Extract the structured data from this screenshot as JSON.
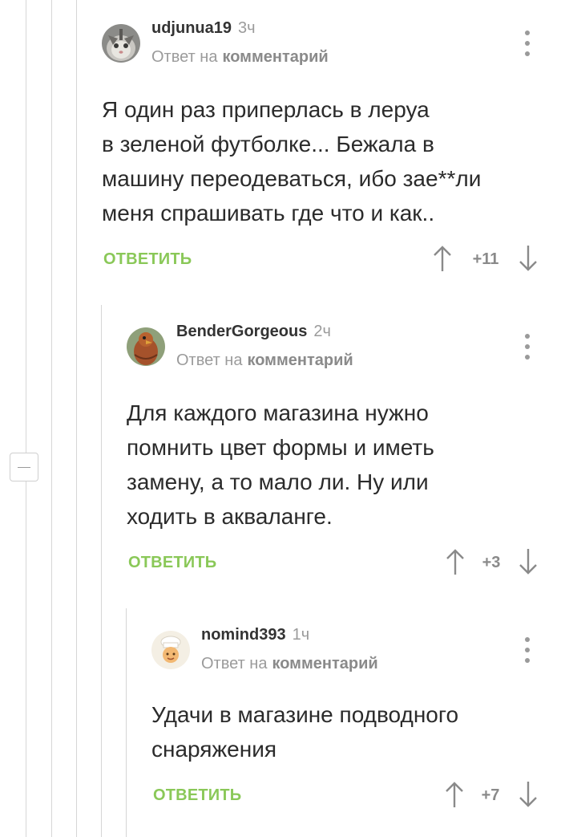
{
  "comments": [
    {
      "author": "udjunua19",
      "time": "3ч",
      "reply_prefix": "Ответ на",
      "reply_link": "комментарий",
      "lines": [
        "Я один раз приперлась в леруа",
        "в зеленой футболке... Бежала в",
        "машину переодеваться, ибо зае**ли",
        "меня спрашивать где что и как.."
      ],
      "reply_label": "ОТВЕТИТЬ",
      "rating": "+11",
      "avatar_icon": "cat-avatar-icon"
    },
    {
      "author": "BenderGorgeous",
      "time": "2ч",
      "reply_prefix": "Ответ на",
      "reply_link": "комментарий",
      "lines": [
        "Для каждого магазина нужно",
        "помнить цвет формы и иметь",
        "замену, а то мало ли. Ну или",
        "ходить в акваланге."
      ],
      "reply_label": "ОТВЕТИТЬ",
      "rating": "+3",
      "avatar_icon": "bird-avatar-icon"
    },
    {
      "author": "nomind393",
      "time": "1ч",
      "reply_prefix": "Ответ на",
      "reply_link": "комментарий",
      "lines": [
        "Удачи в магазине подводного",
        "снаряжения"
      ],
      "reply_label": "ОТВЕТИТЬ",
      "rating": "+7",
      "avatar_icon": "chef-avatar-icon"
    }
  ],
  "colors": {
    "accent_green": "#8ac858",
    "muted_text": "#9b9b9b",
    "thread_line": "#d6d6d6"
  },
  "icons": {
    "collapse": "collapse-thread-icon",
    "more": "more-vertical-icon",
    "upvote": "arrow-up-icon",
    "downvote": "arrow-down-icon"
  }
}
